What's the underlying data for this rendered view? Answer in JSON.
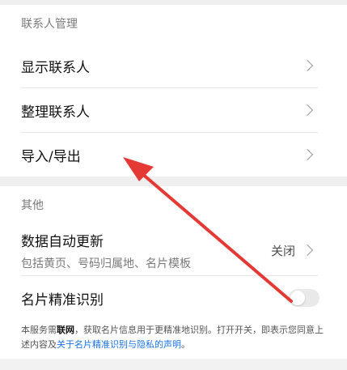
{
  "contacts_section": {
    "header": "联系人管理",
    "items": [
      {
        "label": "显示联系人"
      },
      {
        "label": "整理联系人"
      },
      {
        "label": "导入/导出"
      }
    ]
  },
  "other_section": {
    "header": "其他",
    "auto_update": {
      "label": "数据自动更新",
      "sub": "包括黄页、号码归属地、名片模板",
      "state": "关闭"
    },
    "card_recognition": {
      "label": "名片精准识别",
      "toggle_on": false
    },
    "notice": {
      "prefix": "本服务需",
      "bold": "联网",
      "middle": "，获取名片信息用于更精准地识别。打开开关，即表示您同意上述内容及",
      "link": "关于名片精准识别与隐私的声明",
      "suffix": "。"
    }
  },
  "colors": {
    "annotation_arrow": "#e53935",
    "link": "#1a73e8"
  }
}
